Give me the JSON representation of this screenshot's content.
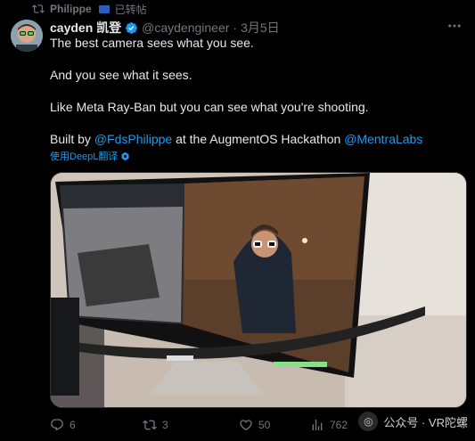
{
  "repost": {
    "label": "Philippe",
    "suffix": "已转帖"
  },
  "author": {
    "name": "cayden 凯登",
    "handle": "@caydengineer",
    "separator": "·",
    "date": "3月5日"
  },
  "tweet": {
    "line1": "The best camera sees what you see.",
    "line2": "And you see what it sees.",
    "line3": "Like Meta Ray-Ban but you can see what you're shooting.",
    "line4_prefix": "Built by ",
    "mention1": "@FdsPhilippe",
    "line4_middle": " at the AugmentOS Hackathon ",
    "mention2": "@MentraLabs"
  },
  "translate_label": "使用DeepL翻译",
  "actions": {
    "reply_count": "6",
    "retweet_count": "3",
    "like_count": "50",
    "views_count": "762"
  },
  "watermark": {
    "text": "公众号 · VR陀螺"
  },
  "colors": {
    "background": "#000000",
    "text": "#e7e9ea",
    "secondary": "#71767b",
    "accent": "#1d9bf0"
  }
}
